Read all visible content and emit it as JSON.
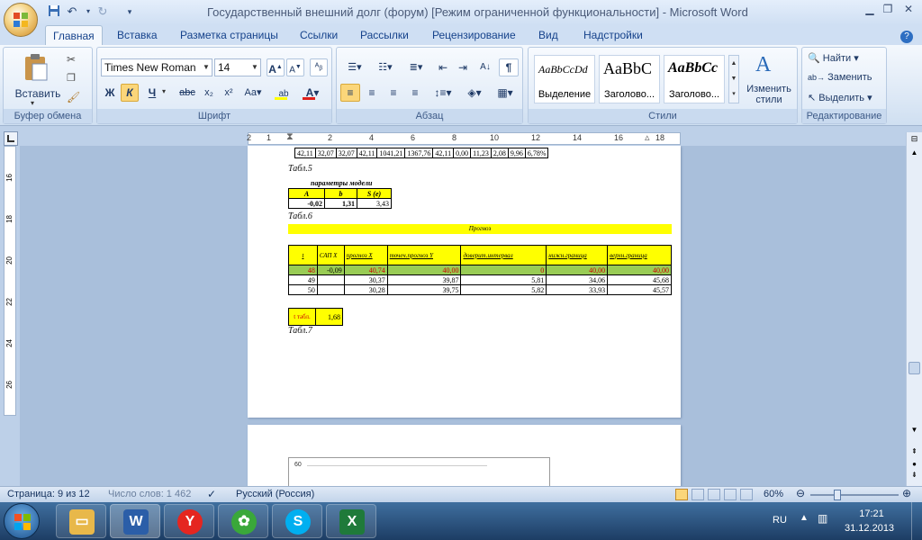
{
  "window": {
    "title": "Государственный внешний долг (форум) [Режим ограниченной функциональности] - Microsoft Word"
  },
  "tabs": [
    "Главная",
    "Вставка",
    "Разметка страницы",
    "Ссылки",
    "Рассылки",
    "Рецензирование",
    "Вид",
    "Надстройки"
  ],
  "ribbon": {
    "clipboard": {
      "paste_label": "Вставить",
      "group_label": "Буфер обмена"
    },
    "font": {
      "name": "Times New Roman",
      "size": "14",
      "group_label": "Шрифт",
      "bold": "Ж",
      "italic": "К",
      "underline": "Ч"
    },
    "paragraph": {
      "group_label": "Абзац"
    },
    "styles": {
      "group_label": "Стили",
      "items": [
        {
          "sample": "AaBbCcDd",
          "name": "Выделение"
        },
        {
          "sample": "AaBbC",
          "name": "Заголово..."
        },
        {
          "sample": "AaBbCc",
          "name": "Заголово..."
        }
      ],
      "change_label": "Изменить стили"
    },
    "editing": {
      "group_label": "Редактирование",
      "find": "Найти",
      "replace": "Заменить",
      "select": "Выделить"
    }
  },
  "ruler": {
    "labels": [
      "2",
      "1",
      "2",
      "4",
      "6",
      "8",
      "10",
      "12",
      "14",
      "16",
      "18"
    ]
  },
  "vruler": {
    "labels": [
      "16",
      "18",
      "20",
      "22",
      "24",
      "26"
    ]
  },
  "document": {
    "top_row": [
      "42,11",
      "32,07",
      "32,07",
      "42,11",
      "1041,21",
      "1367,76",
      "42,11",
      "0,00",
      "11,23",
      "2,08",
      "9,96",
      "6,78%"
    ],
    "cap5": "Табл.5",
    "params_title": "параметры модели",
    "params_headers": [
      "A",
      "b",
      "S (e)"
    ],
    "params_values": [
      "-0,02",
      "1,31",
      "3,43"
    ],
    "cap6": "Табл.6",
    "forecast_title": "Прогноз",
    "forecast_headers": [
      "t",
      "САП X",
      "прогноз X",
      "точеч.прогноз Y",
      "доверит.интервал",
      "нижн.граница",
      "верхн.граница"
    ],
    "forecast_rows": [
      [
        "48",
        "-0,09",
        "40,74",
        "40,00",
        "0",
        "40,00",
        "40,00"
      ],
      [
        "49",
        "",
        "30,37",
        "39,87",
        "5,81",
        "34,06",
        "45,68"
      ],
      [
        "50",
        "",
        "30,28",
        "39,75",
        "5,82",
        "33,93",
        "45,57"
      ]
    ],
    "t_label": "t табл.",
    "t_value": "1,68",
    "cap7": "Табл.7",
    "page2_axis": "60"
  },
  "status": {
    "page": "Страница: 9 из 12",
    "words": "Число слов: 1 462",
    "language": "Русский (Россия)",
    "zoom": "60%"
  },
  "taskbar": {
    "lang": "RU",
    "time": "17:21",
    "date": "31.12.2013"
  },
  "colors": {
    "accent": "#15428b",
    "table_yellow": "#ffff00",
    "table_green": "#99cc55",
    "row_red": "#cc0000"
  }
}
